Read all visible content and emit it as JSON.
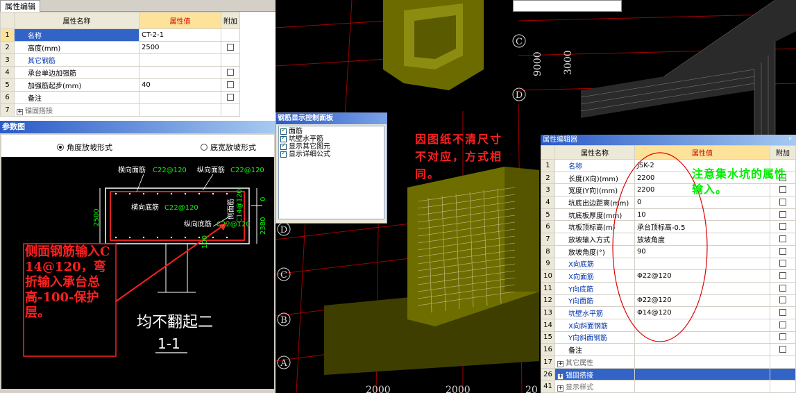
{
  "left_grid": {
    "tab": "属性编辑",
    "headers": {
      "name": "属性名称",
      "value": "属性值",
      "extra": "附加"
    },
    "rows": [
      {
        "n": "1",
        "name": "名称",
        "value": "CT-2-1",
        "cb": false,
        "style": "sel"
      },
      {
        "n": "2",
        "name": "高度(mm)",
        "value": "2500",
        "cb": true,
        "style": "normal"
      },
      {
        "n": "3",
        "name": "其它钢筋",
        "value": "",
        "cb": false,
        "style": "blue"
      },
      {
        "n": "4",
        "name": "承台单边加强筋",
        "value": "",
        "cb": true,
        "style": "normal"
      },
      {
        "n": "5",
        "name": "加强筋起步(mm)",
        "value": "40",
        "cb": true,
        "style": "normal"
      },
      {
        "n": "6",
        "name": "备注",
        "value": "",
        "cb": true,
        "style": "normal"
      },
      {
        "n": "7",
        "name": "锚固搭接",
        "value": "",
        "cb": false,
        "style": "expand"
      }
    ]
  },
  "diagram": {
    "title": "参数图",
    "radio1": "角度放坡形式",
    "radio2": "底宽放坡形式",
    "labels": {
      "top_transverse": "横向面筋",
      "top_transverse_val": "C22@120",
      "top_long": "纵向面筋",
      "top_long_val": "C22@120",
      "bottom_transverse": "横向底筋",
      "bottom_transverse_val": "C22@120",
      "bottom_long": "纵向底筋",
      "bottom_long_val": "C22@120",
      "side": "侧面筋",
      "side_val": "C14@120",
      "dim_left": "2500",
      "dim_right_top": "0",
      "dim_right_bottom": "2380",
      "dim_mid": "100",
      "note": "均不翻起二",
      "section": "1-1"
    },
    "red_note": "侧面钢筋输入C14@120，弯折输入承台总高-100-保护层。"
  },
  "rebar_dialog": {
    "title": "钢筋显示控制面板",
    "items": [
      "面筋",
      "坑壁水平筋",
      "显示其它图元",
      "显示详细公式"
    ]
  },
  "view3d": {
    "axis_labels_left": [
      "D",
      "C",
      "B",
      "A"
    ],
    "axis_labels_top": [
      "C",
      "D"
    ],
    "dims_top": [
      "9000",
      "3000"
    ],
    "dims_bottom": [
      "2000",
      "2000",
      "20"
    ],
    "red_note": "因图纸不清尺寸不对应，方式相同。"
  },
  "right_grid": {
    "title": "属性编辑器",
    "pin": "ᵖ",
    "headers": {
      "name": "属性名称",
      "value": "属性值",
      "extra": "附加"
    },
    "rows": [
      {
        "n": "1",
        "name": "名称",
        "value": "JSK-2",
        "cb": false,
        "style": "blue"
      },
      {
        "n": "2",
        "name": "长度(X向)(mm)",
        "value": "2200",
        "cb": true,
        "style": "normal"
      },
      {
        "n": "3",
        "name": "宽度(Y向)(mm)",
        "value": "2200",
        "cb": true,
        "style": "normal"
      },
      {
        "n": "4",
        "name": "坑底出边距离(mm)",
        "value": "0",
        "cb": true,
        "style": "normal"
      },
      {
        "n": "5",
        "name": "坑底板厚度(mm)",
        "value": "10",
        "cb": true,
        "style": "normal"
      },
      {
        "n": "6",
        "name": "坑板顶标高(m)",
        "value": "承台顶标高-0.5",
        "cb": true,
        "style": "normal"
      },
      {
        "n": "7",
        "name": "放坡输入方式",
        "value": "放坡角度",
        "cb": true,
        "style": "normal"
      },
      {
        "n": "8",
        "name": "放坡角度(°)",
        "value": "90",
        "cb": true,
        "style": "normal"
      },
      {
        "n": "9",
        "name": "X向底筋",
        "value": "",
        "cb": true,
        "style": "blue"
      },
      {
        "n": "10",
        "name": "X向面筋",
        "value": "Φ22@120",
        "cb": true,
        "style": "blue"
      },
      {
        "n": "11",
        "name": "Y向底筋",
        "value": "",
        "cb": true,
        "style": "blue"
      },
      {
        "n": "12",
        "name": "Y向面筋",
        "value": "Φ22@120",
        "cb": true,
        "style": "blue"
      },
      {
        "n": "13",
        "name": "坑壁水平筋",
        "value": "Φ14@120",
        "cb": true,
        "style": "blue"
      },
      {
        "n": "14",
        "name": "X向斜面钢筋",
        "value": "",
        "cb": true,
        "style": "blue"
      },
      {
        "n": "15",
        "name": "Y向斜面钢筋",
        "value": "",
        "cb": true,
        "style": "blue"
      },
      {
        "n": "16",
        "name": "备注",
        "value": "",
        "cb": true,
        "style": "normal"
      },
      {
        "n": "17",
        "name": "其它属性",
        "value": "",
        "cb": false,
        "style": "expand"
      },
      {
        "n": "26",
        "name": "锚固搭接",
        "value": "",
        "cb": false,
        "style": "expandsel"
      },
      {
        "n": "41",
        "name": "显示样式",
        "value": "",
        "cb": false,
        "style": "expand"
      }
    ],
    "green_note": "注意集水坑的属性输入。"
  }
}
